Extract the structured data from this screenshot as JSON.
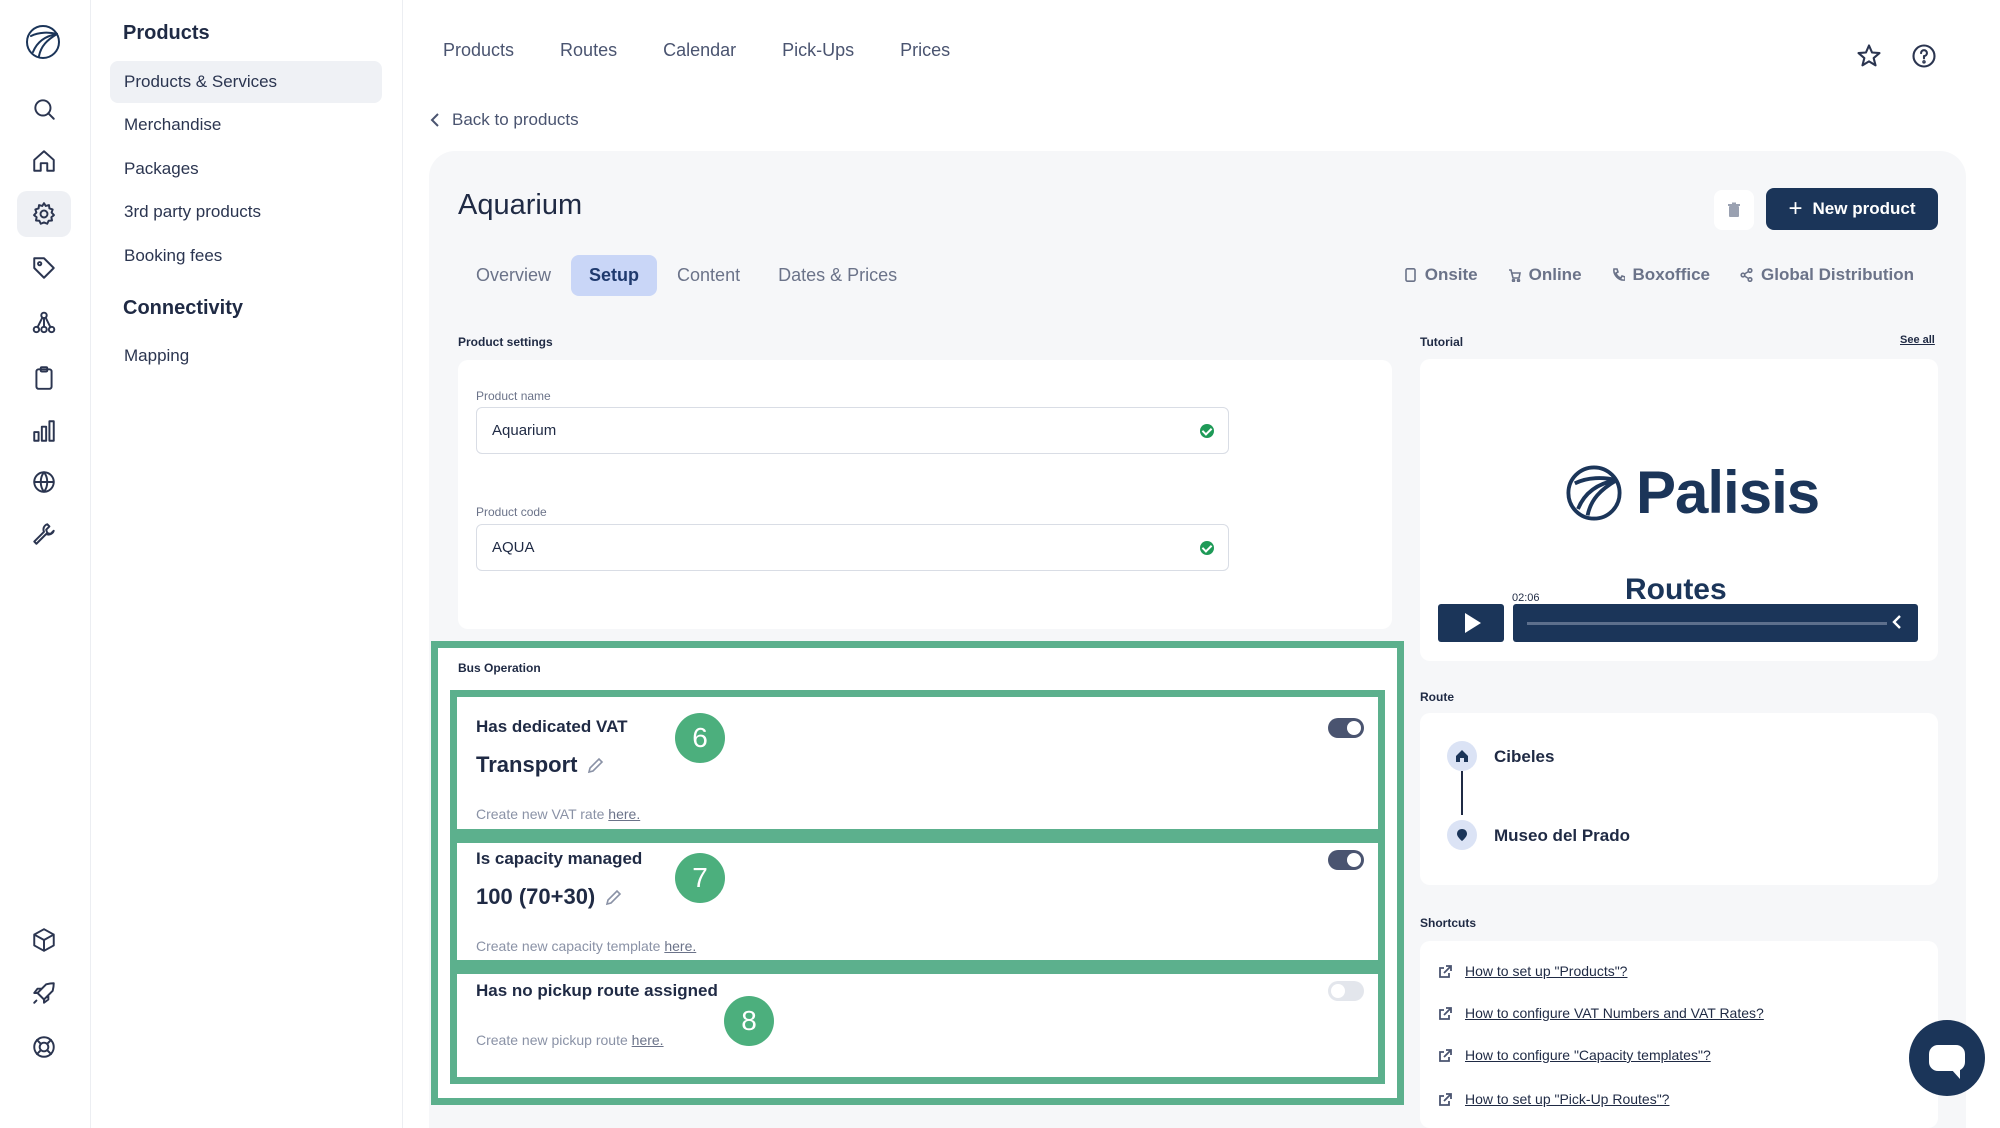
{
  "rail": {
    "items": [
      "search-icon",
      "home-icon",
      "gear-icon",
      "tag-icon",
      "network-icon",
      "clipboard-icon",
      "bar-chart-icon",
      "globe-icon",
      "wrench-icon",
      "cube-icon",
      "rocket-icon",
      "lifebuoy-icon"
    ],
    "active": "gear-icon"
  },
  "sidebar": {
    "group1": "Products",
    "items1": [
      "Products & Services",
      "Merchandise",
      "Packages",
      "3rd party products",
      "Booking fees"
    ],
    "group2": "Connectivity",
    "items2": [
      "Mapping"
    ]
  },
  "topnav": [
    "Products",
    "Routes",
    "Calendar",
    "Pick-Ups",
    "Prices"
  ],
  "back": "Back to products",
  "product": {
    "title": "Aquarium",
    "new_button": "New product",
    "tabs": [
      "Overview",
      "Setup",
      "Content",
      "Dates & Prices"
    ],
    "active_tab": "Setup",
    "channels": [
      "Onsite",
      "Online",
      "Boxoffice",
      "Global Distribution"
    ]
  },
  "settings": {
    "section": "Product settings",
    "name_label": "Product name",
    "name_value": "Aquarium",
    "code_label": "Product code",
    "code_value": "AQUA"
  },
  "bus": {
    "section": "Bus Operation",
    "vat": {
      "title": "Has dedicated VAT",
      "value": "Transport",
      "note": "Create new VAT rate",
      "link": "here.",
      "badge": "6",
      "on": true
    },
    "capacity": {
      "title": "Is capacity managed",
      "value": "100 (70+30)",
      "note": "Create new capacity template",
      "link": "here.",
      "badge": "7",
      "on": true
    },
    "pickup": {
      "title": "Has no pickup route assigned",
      "note": "Create new pickup route",
      "link": "here.",
      "badge": "8",
      "on": false
    }
  },
  "tutorial": {
    "section": "Tutorial",
    "see_all": "See all",
    "brand": "Palisis",
    "video_caption": "Routes",
    "time": "02:06"
  },
  "route": {
    "section": "Route",
    "stops": [
      "Cibeles",
      "Museo del Prado"
    ]
  },
  "shortcuts": {
    "section": "Shortcuts",
    "items": [
      "How to set up \"Products\"?",
      "How to configure VAT Numbers and VAT Rates?",
      "How to configure \"Capacity templates\"?",
      "How to set up \"Pick-Up Routes\"?"
    ]
  },
  "colors": {
    "accent": "#1b3559",
    "highlight": "#5cb08d",
    "tab_active": "#c9d6f7",
    "success": "#1e9a57"
  }
}
